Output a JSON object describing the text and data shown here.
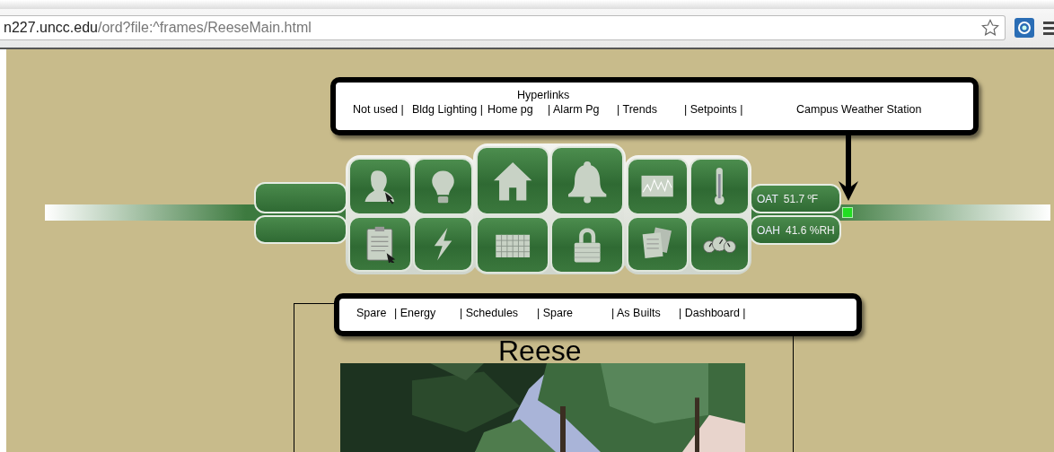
{
  "browser": {
    "url_host": "n227.uncc.edu",
    "url_path": "/ord?file:^frames/ReeseMain.html"
  },
  "top_callout": {
    "heading": "Hyperlinks",
    "links": [
      "Not used |",
      "Bldg Lighting |",
      "Home pg",
      "| Alarm Pg",
      "| Trends",
      "| Setpoints |",
      "Campus Weather Station"
    ]
  },
  "readouts": [
    {
      "label": "OAT",
      "value": "51.7 ºF"
    },
    {
      "label": "OAH",
      "value": "41.6 %RH"
    }
  ],
  "status_dot": {
    "color": "#22dd22"
  },
  "bottom_callout": {
    "links": [
      "Spare",
      "| Energy",
      "| Schedules",
      "| Spare",
      "| As Builts",
      "| Dashboard |"
    ]
  },
  "building": {
    "title": "Reese"
  }
}
